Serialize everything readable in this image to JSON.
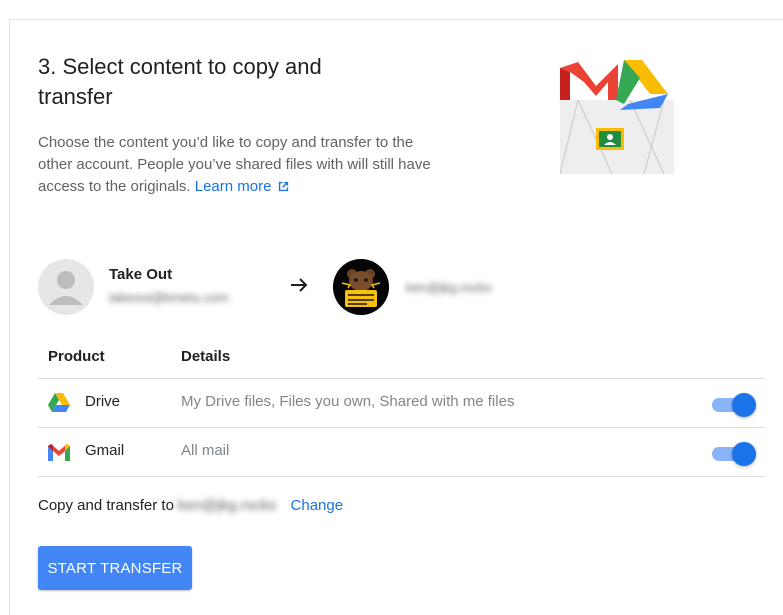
{
  "step": {
    "title": "3. Select content to copy and transfer",
    "description": "Choose the content you’d like to copy and transfer to the other account. People you’ve shared files with will still have access to the originals.",
    "learn_more": "Learn more"
  },
  "source_account": {
    "name": "Take Out",
    "email": "takeout@kmetu.com"
  },
  "destination_account": {
    "avatar_text": "JKG ROCKS",
    "email": "ken@jkg.rocks"
  },
  "table": {
    "headers": [
      "Product",
      "Details"
    ],
    "rows": [
      {
        "product": "Drive",
        "details": "My Drive files, Files you own, Shared with me files",
        "enabled": true,
        "icon": "google-drive-icon"
      },
      {
        "product": "Gmail",
        "details": "All mail",
        "enabled": true,
        "icon": "gmail-icon"
      }
    ]
  },
  "copy_line": {
    "prefix": "Copy and transfer to",
    "email": "ken@jkg.rocks",
    "change": "Change"
  },
  "action": {
    "start_label": "START TRANSFER"
  },
  "colors": {
    "accent": "#1a73e8",
    "button": "#4285f4",
    "toggle_track": "#8ab4f8"
  }
}
